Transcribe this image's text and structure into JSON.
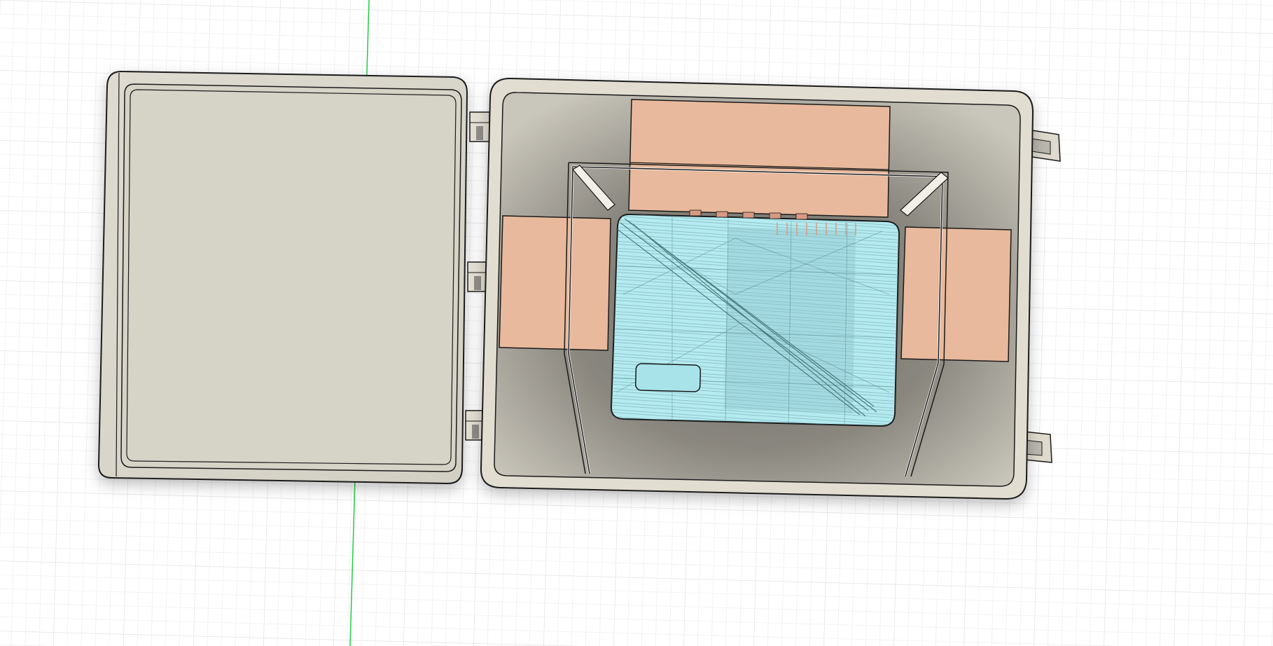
{
  "app": {
    "title": "",
    "view": "CAD viewport"
  },
  "scene": {
    "background_color": "#ffffff",
    "grid_color": "#dedede",
    "axis_color": "#22cc44",
    "lid_color": "#d8d5c9",
    "case_rim_color": "#e1ddd0",
    "case_floor_color": "#9b9890",
    "pad_color": "#e8b99c",
    "device_color": "#b4ebf0",
    "outline_color": "#1a1a1a"
  },
  "objects": {
    "lid": "lid-panel",
    "case": "case-body",
    "device": "device-body",
    "pads": [
      "pad-top",
      "pad-left",
      "pad-right"
    ],
    "hinges": [
      "hinge-top",
      "hinge-middle",
      "hinge-bottom"
    ],
    "tabs": [
      "tab-top",
      "tab-bottom"
    ]
  }
}
